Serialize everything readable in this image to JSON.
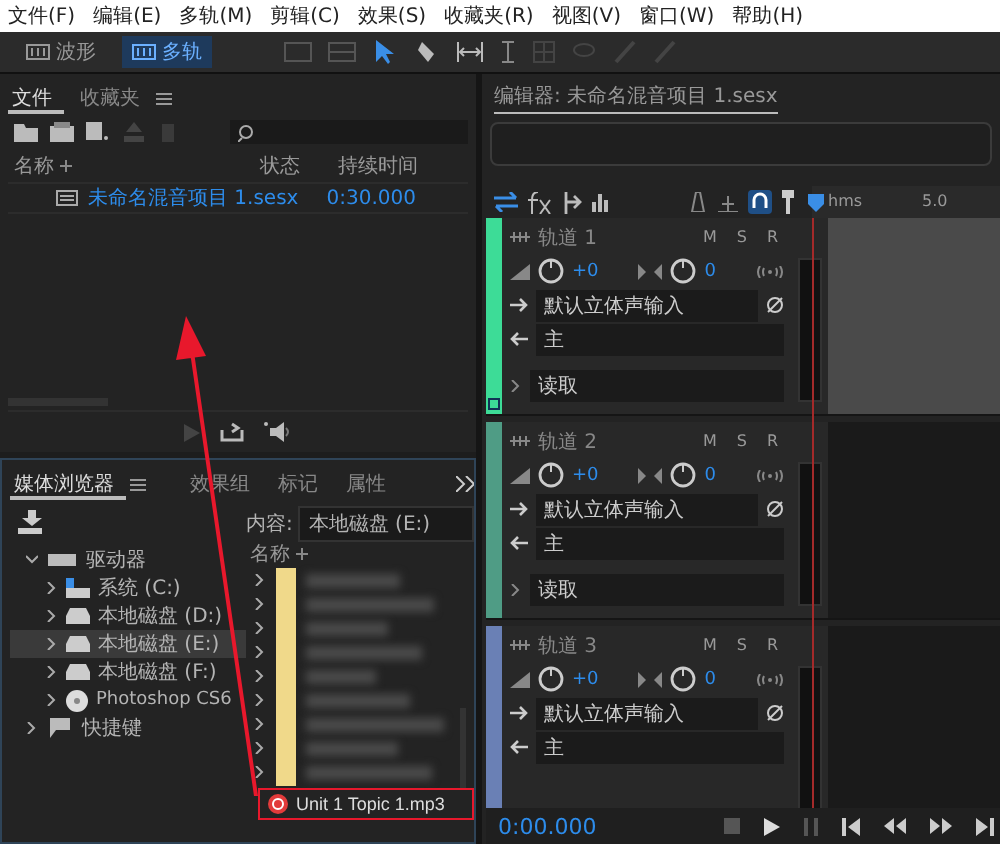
{
  "menu": [
    "文件(F)",
    "编辑(E)",
    "多轨(M)",
    "剪辑(C)",
    "效果(S)",
    "收藏夹(R)",
    "视图(V)",
    "窗口(W)",
    "帮助(H)"
  ],
  "modes": [
    {
      "label": "波形",
      "selected": false
    },
    {
      "label": "多轨",
      "selected": true
    }
  ],
  "files_panel": {
    "tabs": [
      {
        "label": "文件",
        "selected": true
      },
      {
        "label": "收藏夹",
        "selected": false
      }
    ],
    "columns": [
      "名称",
      "状态",
      "持续时间"
    ],
    "rows": [
      {
        "name": "未命名混音项目 1.sesx",
        "duration": "0:30.000",
        "selected": true
      }
    ]
  },
  "media_browser": {
    "tabs": [
      {
        "label": "媒体浏览器",
        "selected": true
      },
      {
        "label": "效果组",
        "selected": false
      },
      {
        "label": "标记",
        "selected": false
      },
      {
        "label": "属性",
        "selected": false
      }
    ],
    "content_label": "内容:",
    "content_value": "本地磁盘 (E:)",
    "tree": [
      {
        "label": "驱动器",
        "kind": "group",
        "expanded": true,
        "children": [
          {
            "label": "系统 (C:)",
            "kind": "system",
            "selected": false
          },
          {
            "label": "本地磁盘 (D:)",
            "kind": "disk",
            "selected": false
          },
          {
            "label": "本地磁盘 (E:)",
            "kind": "disk",
            "selected": true
          },
          {
            "label": "本地磁盘 (F:)",
            "kind": "disk",
            "selected": false
          },
          {
            "label": "Photoshop CS6",
            "kind": "disc",
            "selected": false
          }
        ]
      },
      {
        "label": "快捷键",
        "kind": "shortcut",
        "expanded": false
      }
    ],
    "list_header": "名称",
    "files": [
      {
        "name": "Unit 1 Topic 1.mp3"
      }
    ]
  },
  "editor": {
    "tab": "编辑器: 未命名混音项目 1.sesx",
    "ruler": [
      "hms",
      "5.0"
    ],
    "tracks": [
      {
        "name": "轨道 1",
        "color": "#3ddc97",
        "selected": true,
        "volume": "+0",
        "pan": "0",
        "input": "默认立体声输入",
        "output": "主",
        "automation": "读取",
        "buttons": [
          "M",
          "S",
          "R"
        ]
      },
      {
        "name": "轨道 2",
        "color": "#4f9c85",
        "selected": false,
        "volume": "+0",
        "pan": "0",
        "input": "默认立体声输入",
        "output": "主",
        "automation": "读取",
        "buttons": [
          "M",
          "S",
          "R"
        ]
      },
      {
        "name": "轨道 3",
        "color": "#6a80b5",
        "selected": false,
        "volume": "+0",
        "pan": "0",
        "input": "默认立体声输入",
        "output": "主",
        "buttons": [
          "M",
          "S",
          "R"
        ]
      }
    ],
    "time": "0:00.000"
  }
}
